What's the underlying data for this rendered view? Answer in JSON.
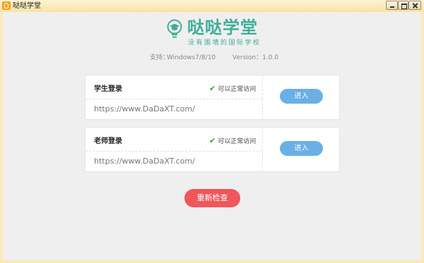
{
  "window": {
    "title": "哒哒学堂"
  },
  "logo": {
    "name": "哒哒学堂",
    "slogan": "没有围墙的国际学校",
    "brand_color": "#3fae99"
  },
  "info": {
    "support_label": "支持：",
    "support_value": "Windows7/8/10",
    "version": "Version：1.0.0"
  },
  "cards": [
    {
      "heading": "学生登录",
      "status": "可以正常访问",
      "url": "https://www.DaDaXT.com/",
      "button": "进入"
    },
    {
      "heading": "老师登录",
      "status": "可以正常访问",
      "url": "https://www.DaDaXT.com/",
      "button": "进入"
    }
  ],
  "recheck_button": "重新检查",
  "colors": {
    "enter_button": "#6ab0e6",
    "recheck_button": "#f0565a",
    "status_ok": "#3a9a3a"
  }
}
